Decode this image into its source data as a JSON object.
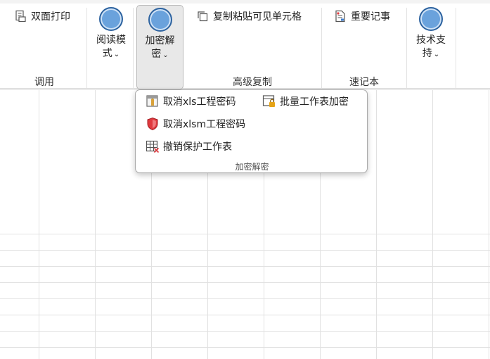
{
  "ribbon": {
    "duplex_print": "双面打印",
    "group_tiaoyong": "调用",
    "reading_mode_line1": "阅读模",
    "reading_mode_line2": "式",
    "encrypt_decrypt_line1": "加密解",
    "encrypt_decrypt_line2": "密",
    "copy_paste_visible": "复制粘贴可见单元格",
    "group_advanced_copy": "高级复制",
    "important_notes": "重要记事",
    "group_notebook": "速记本",
    "tech_support_line1": "技术支",
    "tech_support_line2": "持",
    "chevron": "⌄"
  },
  "dropdown": {
    "items": [
      {
        "label": "取消xls工程密码",
        "icon": "vba-project-icon"
      },
      {
        "label": "批量工作表加密",
        "icon": "sheet-lock-icon"
      },
      {
        "label": "取消xlsm工程密码",
        "icon": "red-shield-icon"
      },
      {
        "label": "撤销保护工作表",
        "icon": "unprotect-sheet-icon"
      }
    ],
    "footer": "加密解密"
  },
  "colors": {
    "circle_fill": "#6aa2dc",
    "circle_border": "#2f64a0",
    "shield_red": "#e0393e",
    "lock_gold": "#e6a417"
  }
}
